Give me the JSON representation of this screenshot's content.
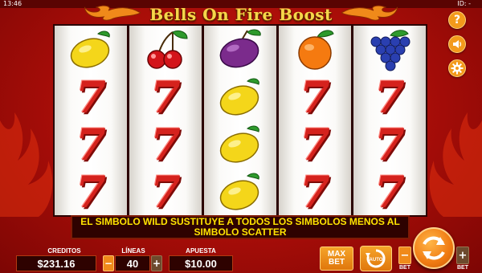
{
  "status_bar": {
    "clock": "13:46",
    "game_id": "ID: -"
  },
  "title": "Bells On Fire Boost",
  "side_icons": {
    "help": "?",
    "sound": "sound-icon",
    "settings": "gear-icon"
  },
  "reels": [
    [
      "lemon",
      "seven",
      "seven",
      "seven"
    ],
    [
      "cherries",
      "seven",
      "seven",
      "seven"
    ],
    [
      "plum",
      "lemon",
      "lemon",
      "lemon"
    ],
    [
      "orange",
      "seven",
      "seven",
      "seven"
    ],
    [
      "grapes",
      "seven",
      "seven",
      "seven"
    ]
  ],
  "seven_glyph": "7",
  "message": "EL SIMBOLO WILD SUSTITUYE A TODOS LOS SIMBOLOS MENOS AL SIMBOLO SCATTER",
  "credits": {
    "label": "CREDITOS",
    "value": "$231.16"
  },
  "lines": {
    "label": "LÍNEAS",
    "value": "40",
    "minus": "−",
    "plus": "+"
  },
  "bet": {
    "label": "APUESTA",
    "value": "$10.00"
  },
  "buttons": {
    "max_bet_line1": "MAX",
    "max_bet_line2": "BET",
    "auto": "AUTO",
    "bet_minus": "−",
    "bet_minus_label": "BET",
    "bet_plus": "+",
    "bet_plus_label": "BET"
  },
  "colors": {
    "background": "#b3100a",
    "title": "#f7d64a",
    "message_text": "#ffe400",
    "accent": "#f39a1b",
    "seven": "#d5221d"
  }
}
